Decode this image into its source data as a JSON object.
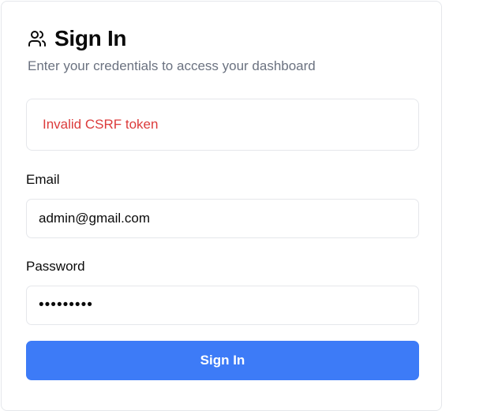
{
  "header": {
    "icon": "users-icon",
    "title": "Sign In",
    "subtitle": "Enter your credentials to access your dashboard"
  },
  "alert": {
    "message": "Invalid CSRF token",
    "color": "#dc3b3b"
  },
  "form": {
    "email_label": "Email",
    "email_value": "admin@gmail.com",
    "password_label": "Password",
    "password_value": "•••••••••",
    "submit_label": "Sign In"
  },
  "colors": {
    "accent": "#3d7bf7",
    "muted_text": "#6b7280",
    "border": "#e5e7eb"
  }
}
